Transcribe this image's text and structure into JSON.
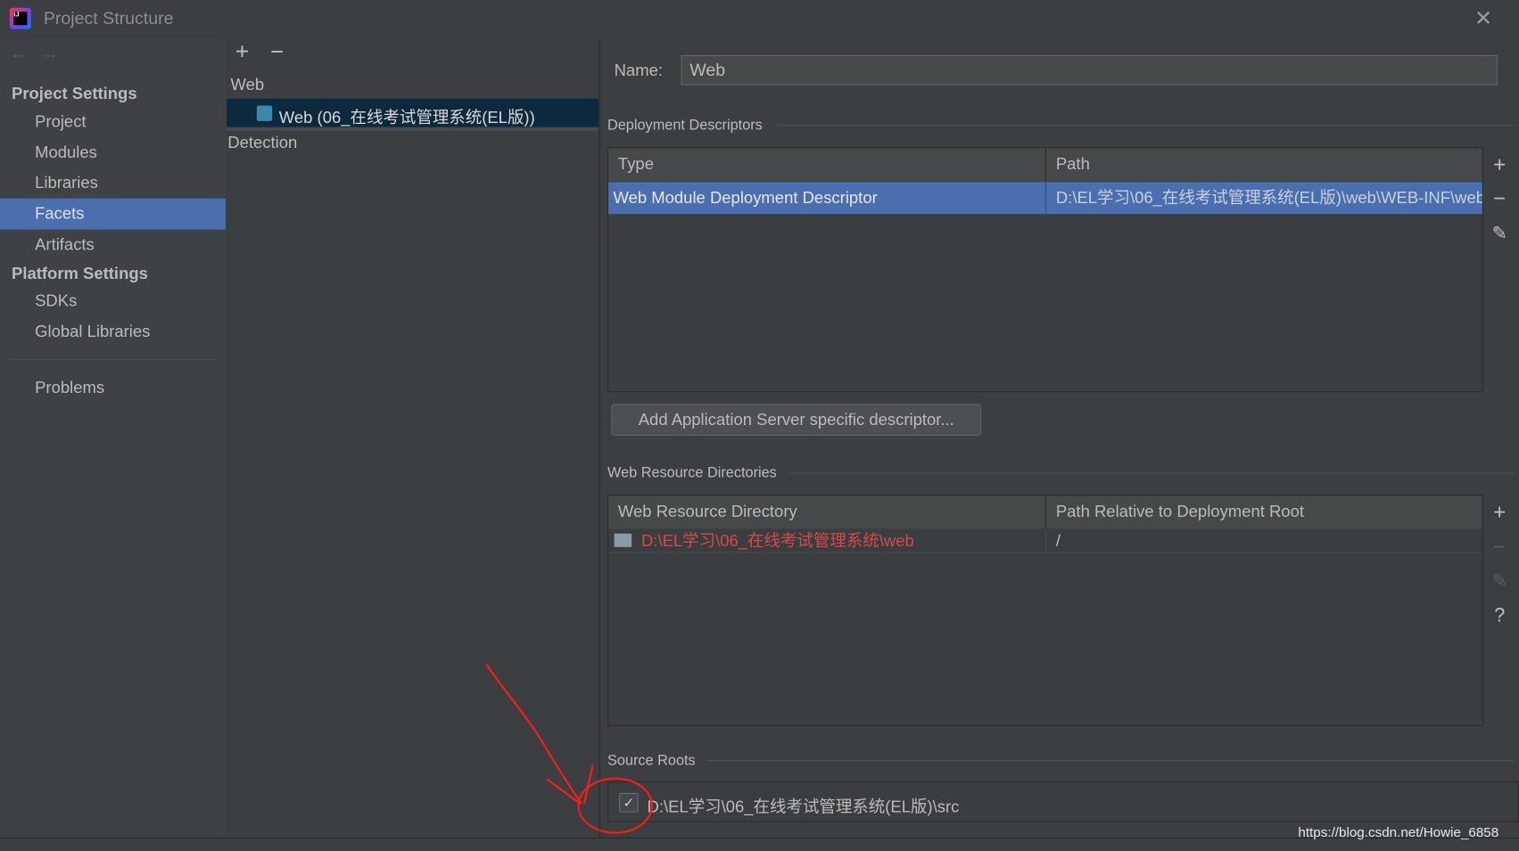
{
  "window": {
    "title": "Project Structure",
    "close_icon": "close-icon"
  },
  "sidebar": {
    "project_settings": "Project Settings",
    "platform_settings": "Platform Settings",
    "items": [
      {
        "label": "Project"
      },
      {
        "label": "Modules"
      },
      {
        "label": "Libraries"
      },
      {
        "label": "Facets",
        "selected": true
      },
      {
        "label": "Artifacts"
      }
    ],
    "platform_items": [
      {
        "label": "SDKs"
      },
      {
        "label": "Global Libraries"
      }
    ],
    "problems": "Problems"
  },
  "middle": {
    "group": "Web",
    "facet": "Web (06_在线考试管理系统(EL版))",
    "detection": "Detection"
  },
  "detail": {
    "name_label": "Name:",
    "name_value": "Web",
    "deployment": {
      "title": "Deployment Descriptors",
      "columns": [
        "Type",
        "Path"
      ],
      "rows": [
        {
          "type": "Web Module Deployment Descriptor",
          "path": "D:\\EL学习\\06_在线考试管理系统(EL版)\\web\\WEB-INF\\web"
        }
      ]
    },
    "add_server_button": "Add Application Server specific descriptor...",
    "web_resources": {
      "title": "Web Resource Directories",
      "columns": [
        "Web Resource Directory",
        "Path Relative to Deployment Root"
      ],
      "rows": [
        {
          "dir": "D:\\EL学习\\06_在线考试管理系统\\web",
          "relative": "/"
        }
      ]
    },
    "source_roots": {
      "title": "Source Roots",
      "items": [
        {
          "path": "D:\\EL学习\\06_在线考试管理系统(EL版)\\src",
          "checked": true
        }
      ]
    }
  },
  "watermark": "https://blog.csdn.net/Howie_6858",
  "colors": {
    "selection": "#4b6eaf",
    "error_text": "#d84747",
    "annotation": "#ff0000"
  }
}
